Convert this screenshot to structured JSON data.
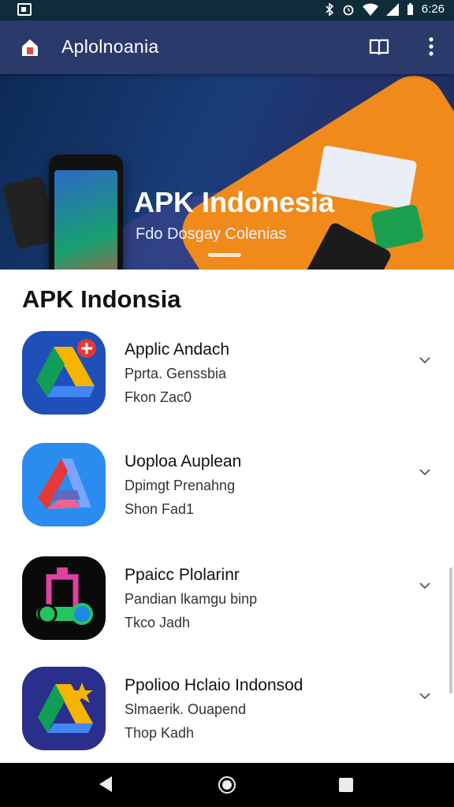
{
  "status_bar": {
    "time": "6:26",
    "icons": [
      "notification-icon",
      "bluetooth-icon",
      "alarm-icon",
      "wifi-icon",
      "signal-icon",
      "battery-icon"
    ]
  },
  "app_bar": {
    "title": "Aplolnoania",
    "icons": [
      "home-icon",
      "book-icon",
      "more-vert-icon"
    ]
  },
  "banner": {
    "headline": "APK Indonesia",
    "subline": "Fdo Dosgay Colenias",
    "colors": {
      "background": "#1a3d7a",
      "accent": "#f08a1a"
    }
  },
  "section": {
    "title": "APK Indonsia"
  },
  "apps": [
    {
      "name": "Applic Andach",
      "sub": "Pprta. Genssbia",
      "size": "Fkon Zac0",
      "icon": "drive-icon"
    },
    {
      "name": "Uoploa Auplean",
      "sub": "Dpimgt Prenahng",
      "size": "Shon Fad1",
      "icon": "arrow-app-icon"
    },
    {
      "name": "Ppaicc Plolarinr",
      "sub": "Pandian lkamgu binp",
      "size": "Tkco Jadh",
      "icon": "key-app-icon"
    },
    {
      "name": "Ppolioo Hclaio Indonsod",
      "sub": "Slmaerik. Ouapend",
      "size": "Thop Kadh",
      "icon": "drive-star-icon"
    }
  ],
  "navbar": {
    "icons": [
      "back-icon",
      "home-circle-icon",
      "recents-icon"
    ]
  }
}
